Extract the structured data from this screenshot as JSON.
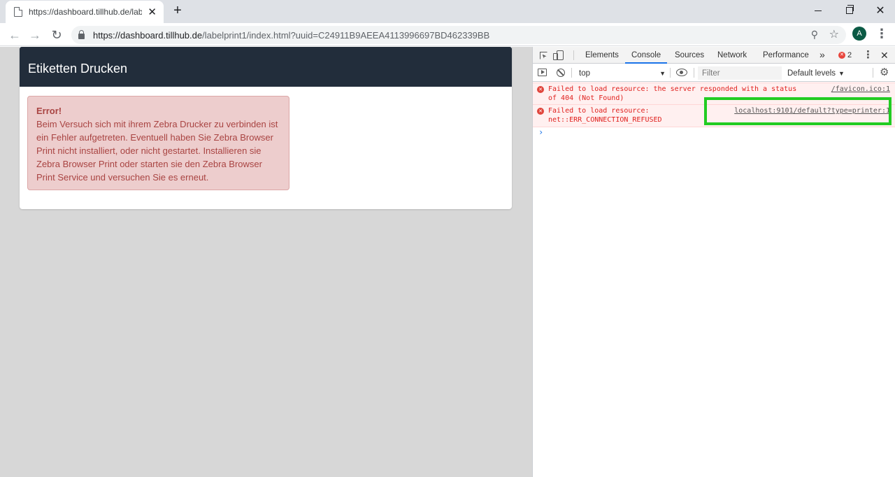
{
  "browser": {
    "tab_title": "https://dashboard.tillhub.de/labe",
    "tab_close": "✕",
    "new_tab": "+",
    "window_minimize": "",
    "window_restore": "",
    "window_close": "✕",
    "back": "←",
    "forward": "→",
    "reload": "↻",
    "url_host": "https://dashboard.tillhub.de",
    "url_path": "/labelprint1/index.html?uuid=C24911B9AEEA4113996697BD462339BB",
    "zoom_icon": "⚲",
    "bookmark_icon": "☆",
    "avatar_letter": "A",
    "menu": "⋮"
  },
  "page": {
    "panel_title": "Etiketten Drucken",
    "alert_heading": "Error!",
    "alert_body": "Beim Versuch sich mit ihrem Zebra Drucker zu verbinden ist ein Fehler aufgetreten. Eventuell haben Sie Zebra Browser Print nicht installiert, oder nicht gestartet. Installieren sie Zebra Browser Print oder starten sie den Zebra Browser Print Service und versuchen Sie es erneut."
  },
  "devtools": {
    "tabs": [
      {
        "label": "Elements",
        "active": false
      },
      {
        "label": "Console",
        "active": true
      },
      {
        "label": "Sources",
        "active": false
      },
      {
        "label": "Network",
        "active": false
      },
      {
        "label": "Performance",
        "active": false
      }
    ],
    "more_tabs": "»",
    "error_count": "2",
    "kebab": "⋮",
    "close": "✕",
    "context": "top",
    "filter_placeholder": "Filter",
    "levels": "Default levels",
    "gear": "⚙",
    "messages": [
      {
        "text": "Failed to load resource: the server responded with a status\nof 404 (Not Found)",
        "source": "/favicon.ico:1"
      },
      {
        "text": "Failed to load resource:\nnet::ERR_CONNECTION_REFUSED",
        "source": "localhost:9101/default?type=printer:1"
      }
    ],
    "prompt": "›",
    "highlight_color": "#22cc22"
  }
}
